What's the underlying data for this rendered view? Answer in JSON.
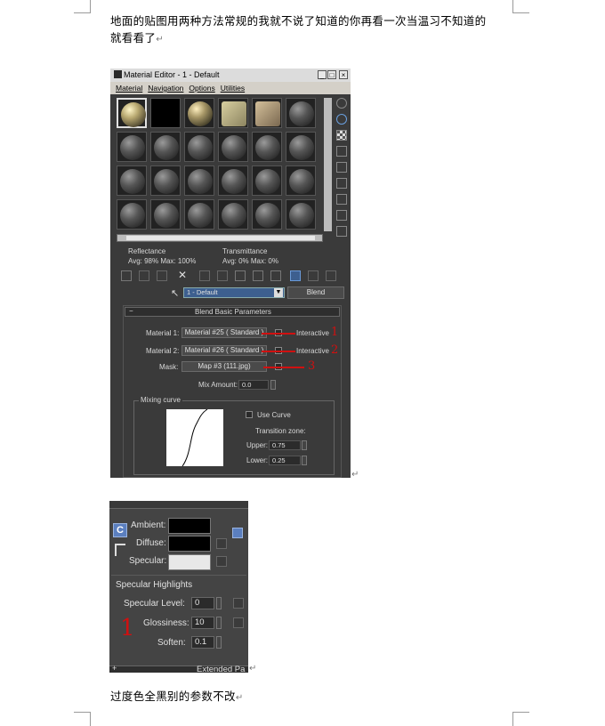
{
  "document": {
    "paragraph1_line1": "地面的贴图用两种方法常规的我就不说了知道的你再看一次当温习不知道的",
    "paragraph1_line2": "就看看了",
    "paragraph2": "过度色全黑别的参数不改",
    "return_mark": "↵"
  },
  "material_editor": {
    "title": "Material Editor - 1 - Default",
    "window_buttons": [
      "_",
      "□",
      "×"
    ],
    "menu": [
      "Material",
      "Navigation",
      "Options",
      "Utilities"
    ],
    "reflectance_label": "Reflectance",
    "reflectance_values": "Avg:   98% Max: 100%",
    "transmittance_label": "Transmittance",
    "transmittance_values": "Avg:     0% Max:     0%",
    "material_name": "1 - Default",
    "type_button": "Blend",
    "rollout_title": "Blend Basic Parameters",
    "rollout_collapse": "−",
    "material1_label": "Material 1:",
    "material1_value": "Material #25  ( Standard )",
    "material2_label": "Material 2:",
    "material2_value": "Material #26  ( Standard )",
    "mask_label": "Mask:",
    "mask_value": "Map #3 (111.jpg)",
    "interactive_label": "Interactive",
    "mix_amount_label": "Mix Amount:",
    "mix_amount_value": "0.0",
    "mixing_curve_label": "Mixing curve",
    "use_curve_label": "Use Curve",
    "transition_zone_label": "Transition zone:",
    "upper_label": "Upper:",
    "upper_value": "0.75",
    "lower_label": "Lower:",
    "lower_value": "0.25",
    "annotations": [
      "1",
      "2",
      "3"
    ]
  },
  "shader_panel": {
    "ambient_label": "Ambient:",
    "diffuse_label": "Diffuse:",
    "specular_label": "Specular:",
    "lock_symbol": "C",
    "specular_highlights_title": "Specular Highlights",
    "specular_level_label": "Specular Level:",
    "specular_level_value": "0",
    "glossiness_label": "Glossiness:",
    "glossiness_value": "10",
    "soften_label": "Soften:",
    "soften_value": "0.1",
    "annotation": "1",
    "extended_label": "Extended Pa",
    "extended_collapse": "+",
    "colors": {
      "ambient": "#000000",
      "diffuse": "#000000",
      "specular": "#e8e8e8"
    }
  }
}
